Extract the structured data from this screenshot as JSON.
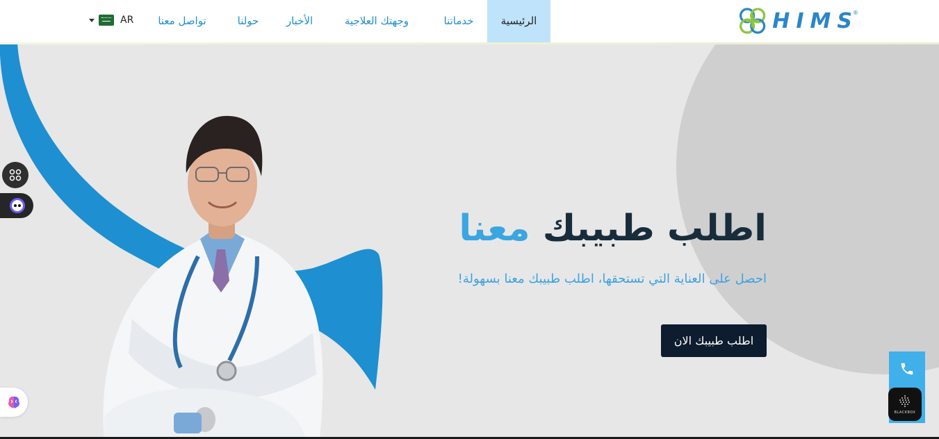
{
  "header": {
    "logo_text": "HIMS",
    "logo_reg": "®",
    "nav": [
      {
        "label": "الرئيسية",
        "active": true
      },
      {
        "label": "خدماتنا",
        "active": false
      },
      {
        "label": "وجهتك العلاجية",
        "active": false
      },
      {
        "label": "الأخبار",
        "active": false
      },
      {
        "label": "حولنا",
        "active": false
      },
      {
        "label": "تواصل معنا",
        "active": false
      }
    ],
    "language": {
      "label": "AR",
      "icon": "saudi-flag-icon"
    }
  },
  "hero": {
    "headline_main": "اطلب طبيبك",
    "headline_accent": "معنا",
    "subline": "احصل على العناية التي تستحقها، اطلب طبيبك معنا بسهولة!",
    "cta_label": "اطلب طبيبك الان"
  },
  "widgets": {
    "apps_icon": "grid-icon",
    "chat_icon": "chat-bot-icon",
    "brain_icon": "brain-icon",
    "phone_icon": "phone-icon",
    "blackbox_label": "BLACKBOX"
  },
  "colors": {
    "accent": "#3aa6e0",
    "dark": "#0d1c2e",
    "nav_active_bg": "#bfe3fb",
    "hero_bg": "#e7e7e8",
    "blue_swoosh": "#1e8fd0"
  }
}
